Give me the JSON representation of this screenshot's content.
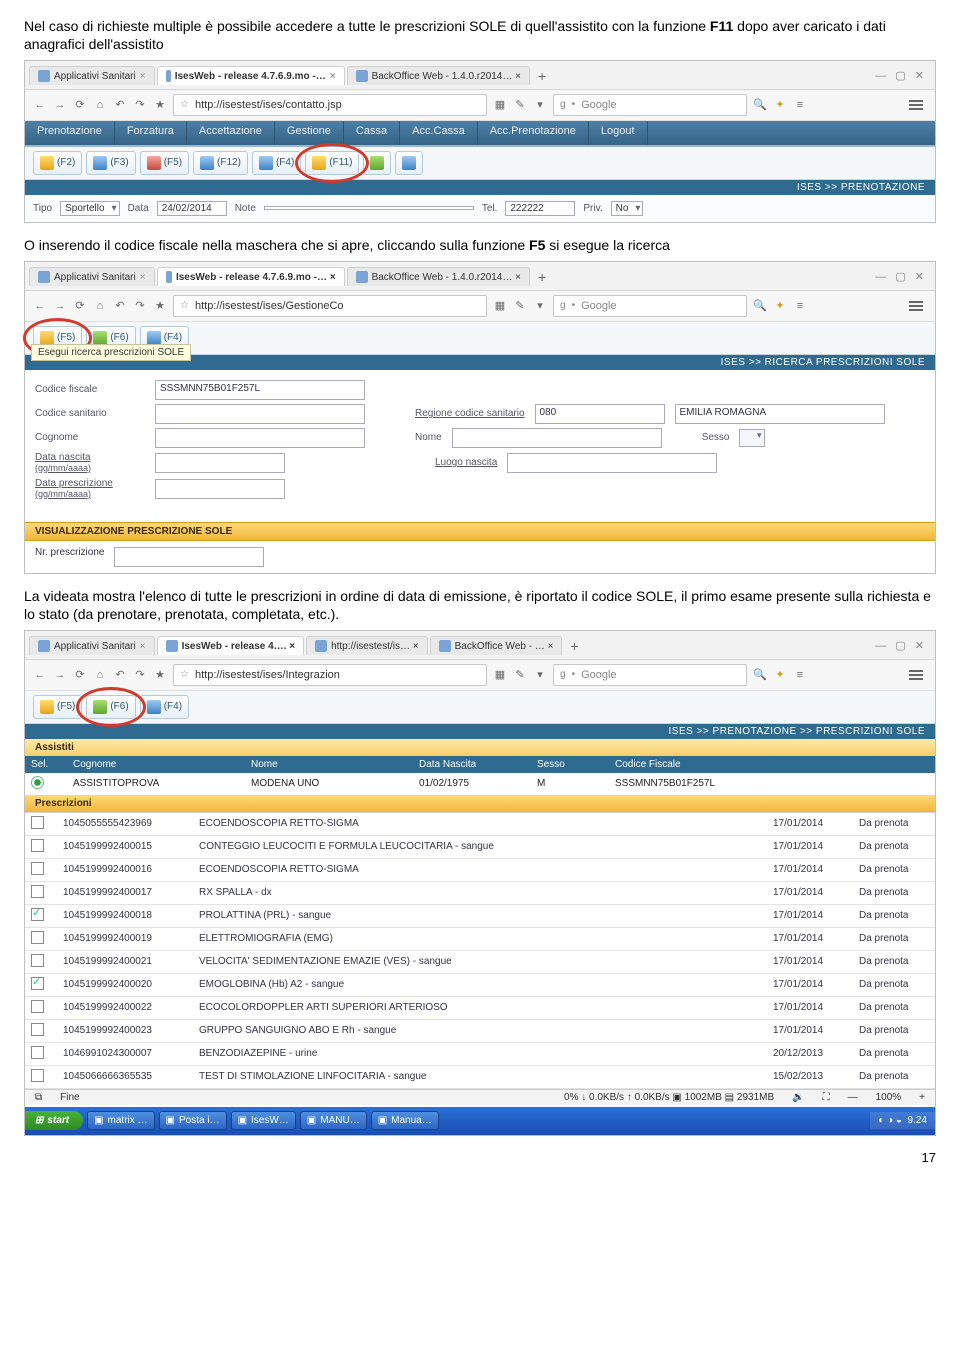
{
  "para1_a": "Nel caso di richieste multiple è possibile accedere a tutte le prescrizioni SOLE di quell'assistito con la funzione ",
  "para1_b": "F11",
  "para1_c": " dopo aver caricato i dati anagrafici dell'assistito",
  "para2_a": "O inserendo il codice fiscale nella maschera che si apre, cliccando sulla funzione ",
  "para2_b": "F5",
  "para2_c": " si esegue la ricerca",
  "para3": "La videata mostra l'elenco di tutte le prescrizioni in ordine di data di emissione, è riportato il codice SOLE, il primo esame presente sulla richiesta e lo stato (da prenotare, prenotata, completata, etc.).",
  "page_number": "17",
  "shot1": {
    "tabs": [
      {
        "label": "Applicativi Sanitari"
      },
      {
        "label": "IsesWeb - release 4.7.6.9.mo -…"
      },
      {
        "label": "BackOffice Web - 1.4.0.r2014… ×"
      }
    ],
    "url": "http://isestest/ises/contatto.jsp",
    "search_placeholder": "Google",
    "menu": [
      "Prenotazione",
      "Forzatura",
      "Accettazione",
      "Gestione",
      "Cassa",
      "Acc.Cassa",
      "Acc.Prenotazione",
      "Logout"
    ],
    "fbtns": [
      "(F2)",
      "(F3)",
      "(F5)",
      "(F12)",
      "(F4)",
      "(F11)"
    ],
    "breadcrumb": "ISES >> PRENOTAZIONE",
    "strip": {
      "tipo_label": "Tipo",
      "tipo_val": "Sportello",
      "data_label": "Data",
      "data_val": "24/02/2014",
      "note_label": "Note",
      "tel_label": "Tel.",
      "tel_val": "222222",
      "priv_label": "Priv.",
      "priv_val": "No"
    }
  },
  "shot2": {
    "tabs": [
      {
        "label": "Applicativi Sanitari"
      },
      {
        "label": "IsesWeb - release 4.7.6.9.mo -… ×"
      },
      {
        "label": "BackOffice Web - 1.4.0.r2014… ×"
      }
    ],
    "url": "http://isestest/ises/GestioneCo",
    "search_placeholder": "Google",
    "fbtns": [
      "(F5)",
      "(F6)",
      "(F4)"
    ],
    "tooltip": "Esegui ricerca prescrizioni SOLE",
    "breadcrumb": "ISES >> RICERCA PRESCRIZIONI SOLE",
    "form": {
      "cf_label": "Codice fiscale",
      "cf_val": "SSSMNN75B01F257L",
      "cs_label": "Codice sanitario",
      "cs_val": "",
      "rcs_label": "Regione codice sanitario",
      "rcs_code": "080",
      "rcs_val": "EMILIA ROMAGNA",
      "cogn_label": "Cognome",
      "nome_label": "Nome",
      "sesso_label": "Sesso",
      "dn_label": "Data nascita",
      "dn_hint": "(gg/mm/aaaa)",
      "ln_label": "Luogo nascita",
      "dp_label": "Data prescrizione",
      "dp_hint": "(gg/mm/aaaa)"
    },
    "section_title": "VISUALIZZAZIONE PRESCRIZIONE SOLE",
    "nr_label": "Nr. prescrizione"
  },
  "shot3": {
    "tabs": [
      {
        "label": "Applicativi Sanitari"
      },
      {
        "label": "IsesWeb - release 4…. ×"
      },
      {
        "label": "http://isestest/is… ×"
      },
      {
        "label": "BackOffice Web - … ×"
      }
    ],
    "url": "http://isestest/ises/Integrazion",
    "search_placeholder": "Google",
    "fbtns": [
      "(F5)",
      "(F6)",
      "(F4)"
    ],
    "breadcrumb": "ISES >> PRENOTAZIONE >> PRESCRIZIONI SOLE",
    "assistiti_label": "Assistiti",
    "cols": {
      "sel": "Sel.",
      "cogn": "Cognome",
      "nome": "Nome",
      "dn": "Data Nascita",
      "sesso": "Sesso",
      "cf": "Codice Fiscale"
    },
    "row": {
      "cogn": "ASSISTITOPROVA",
      "nome": "MODENA UNO",
      "dn": "01/02/1975",
      "sesso": "M",
      "cf": "SSSMNN75B01F257L"
    },
    "presc_header": "Prescrizioni",
    "prescriptions": [
      {
        "chk": false,
        "id": "1045055555423969",
        "desc": "ECOENDOSCOPIA RETTO-SIGMA",
        "date": "17/01/2014",
        "stat": "Da prenota"
      },
      {
        "chk": false,
        "id": "1045199992400015",
        "desc": "CONTEGGIO LEUCOCITI E FORMULA LEUCOCITARIA - sangue",
        "date": "17/01/2014",
        "stat": "Da prenota"
      },
      {
        "chk": false,
        "id": "1045199992400016",
        "desc": "ECOENDOSCOPIA RETTO-SIGMA",
        "date": "17/01/2014",
        "stat": "Da prenota"
      },
      {
        "chk": false,
        "id": "1045199992400017",
        "desc": "RX SPALLA - dx",
        "date": "17/01/2014",
        "stat": "Da prenota"
      },
      {
        "chk": true,
        "id": "1045199992400018",
        "desc": "PROLATTINA (PRL) - sangue",
        "date": "17/01/2014",
        "stat": "Da prenota"
      },
      {
        "chk": false,
        "id": "1045199992400019",
        "desc": "ELETTROMIOGRAFIA (EMG)",
        "date": "17/01/2014",
        "stat": "Da prenota"
      },
      {
        "chk": false,
        "id": "1045199992400021",
        "desc": "VELOCITA' SEDIMENTAZIONE EMAZIE (VES) - sangue",
        "date": "17/01/2014",
        "stat": "Da prenota"
      },
      {
        "chk": true,
        "id": "1045199992400020",
        "desc": "EMOGLOBINA (Hb) A2 - sangue",
        "date": "17/01/2014",
        "stat": "Da prenota"
      },
      {
        "chk": false,
        "id": "1045199992400022",
        "desc": "ECOCOLORDOPPLER ARTI SUPERIORI ARTERIOSO",
        "date": "17/01/2014",
        "stat": "Da prenota"
      },
      {
        "chk": false,
        "id": "1045199992400023",
        "desc": "GRUPPO SANGUIGNO ABO E Rh - sangue",
        "date": "17/01/2014",
        "stat": "Da prenota"
      },
      {
        "chk": false,
        "id": "1046991024300007",
        "desc": "BENZODIAZEPINE - urine",
        "date": "20/12/2013",
        "stat": "Da prenota"
      },
      {
        "chk": false,
        "id": "1045066666365535",
        "desc": "TEST DI STIMOLAZIONE LINFOCITARIA - sangue",
        "date": "15/02/2013",
        "stat": "Da prenota"
      }
    ],
    "status": {
      "fine": "Fine",
      "speed": "0%  ↓ 0.0KB/s  ↑ 0.0KB/s  ▣ 1002MB  ▤ 2931MB",
      "zoom": "100%"
    },
    "taskbar": {
      "start": "start",
      "btns": [
        "matrix …",
        "Posta i…",
        "IsesW…",
        "MANU…",
        "Manua…"
      ],
      "clock": "9.24"
    }
  }
}
